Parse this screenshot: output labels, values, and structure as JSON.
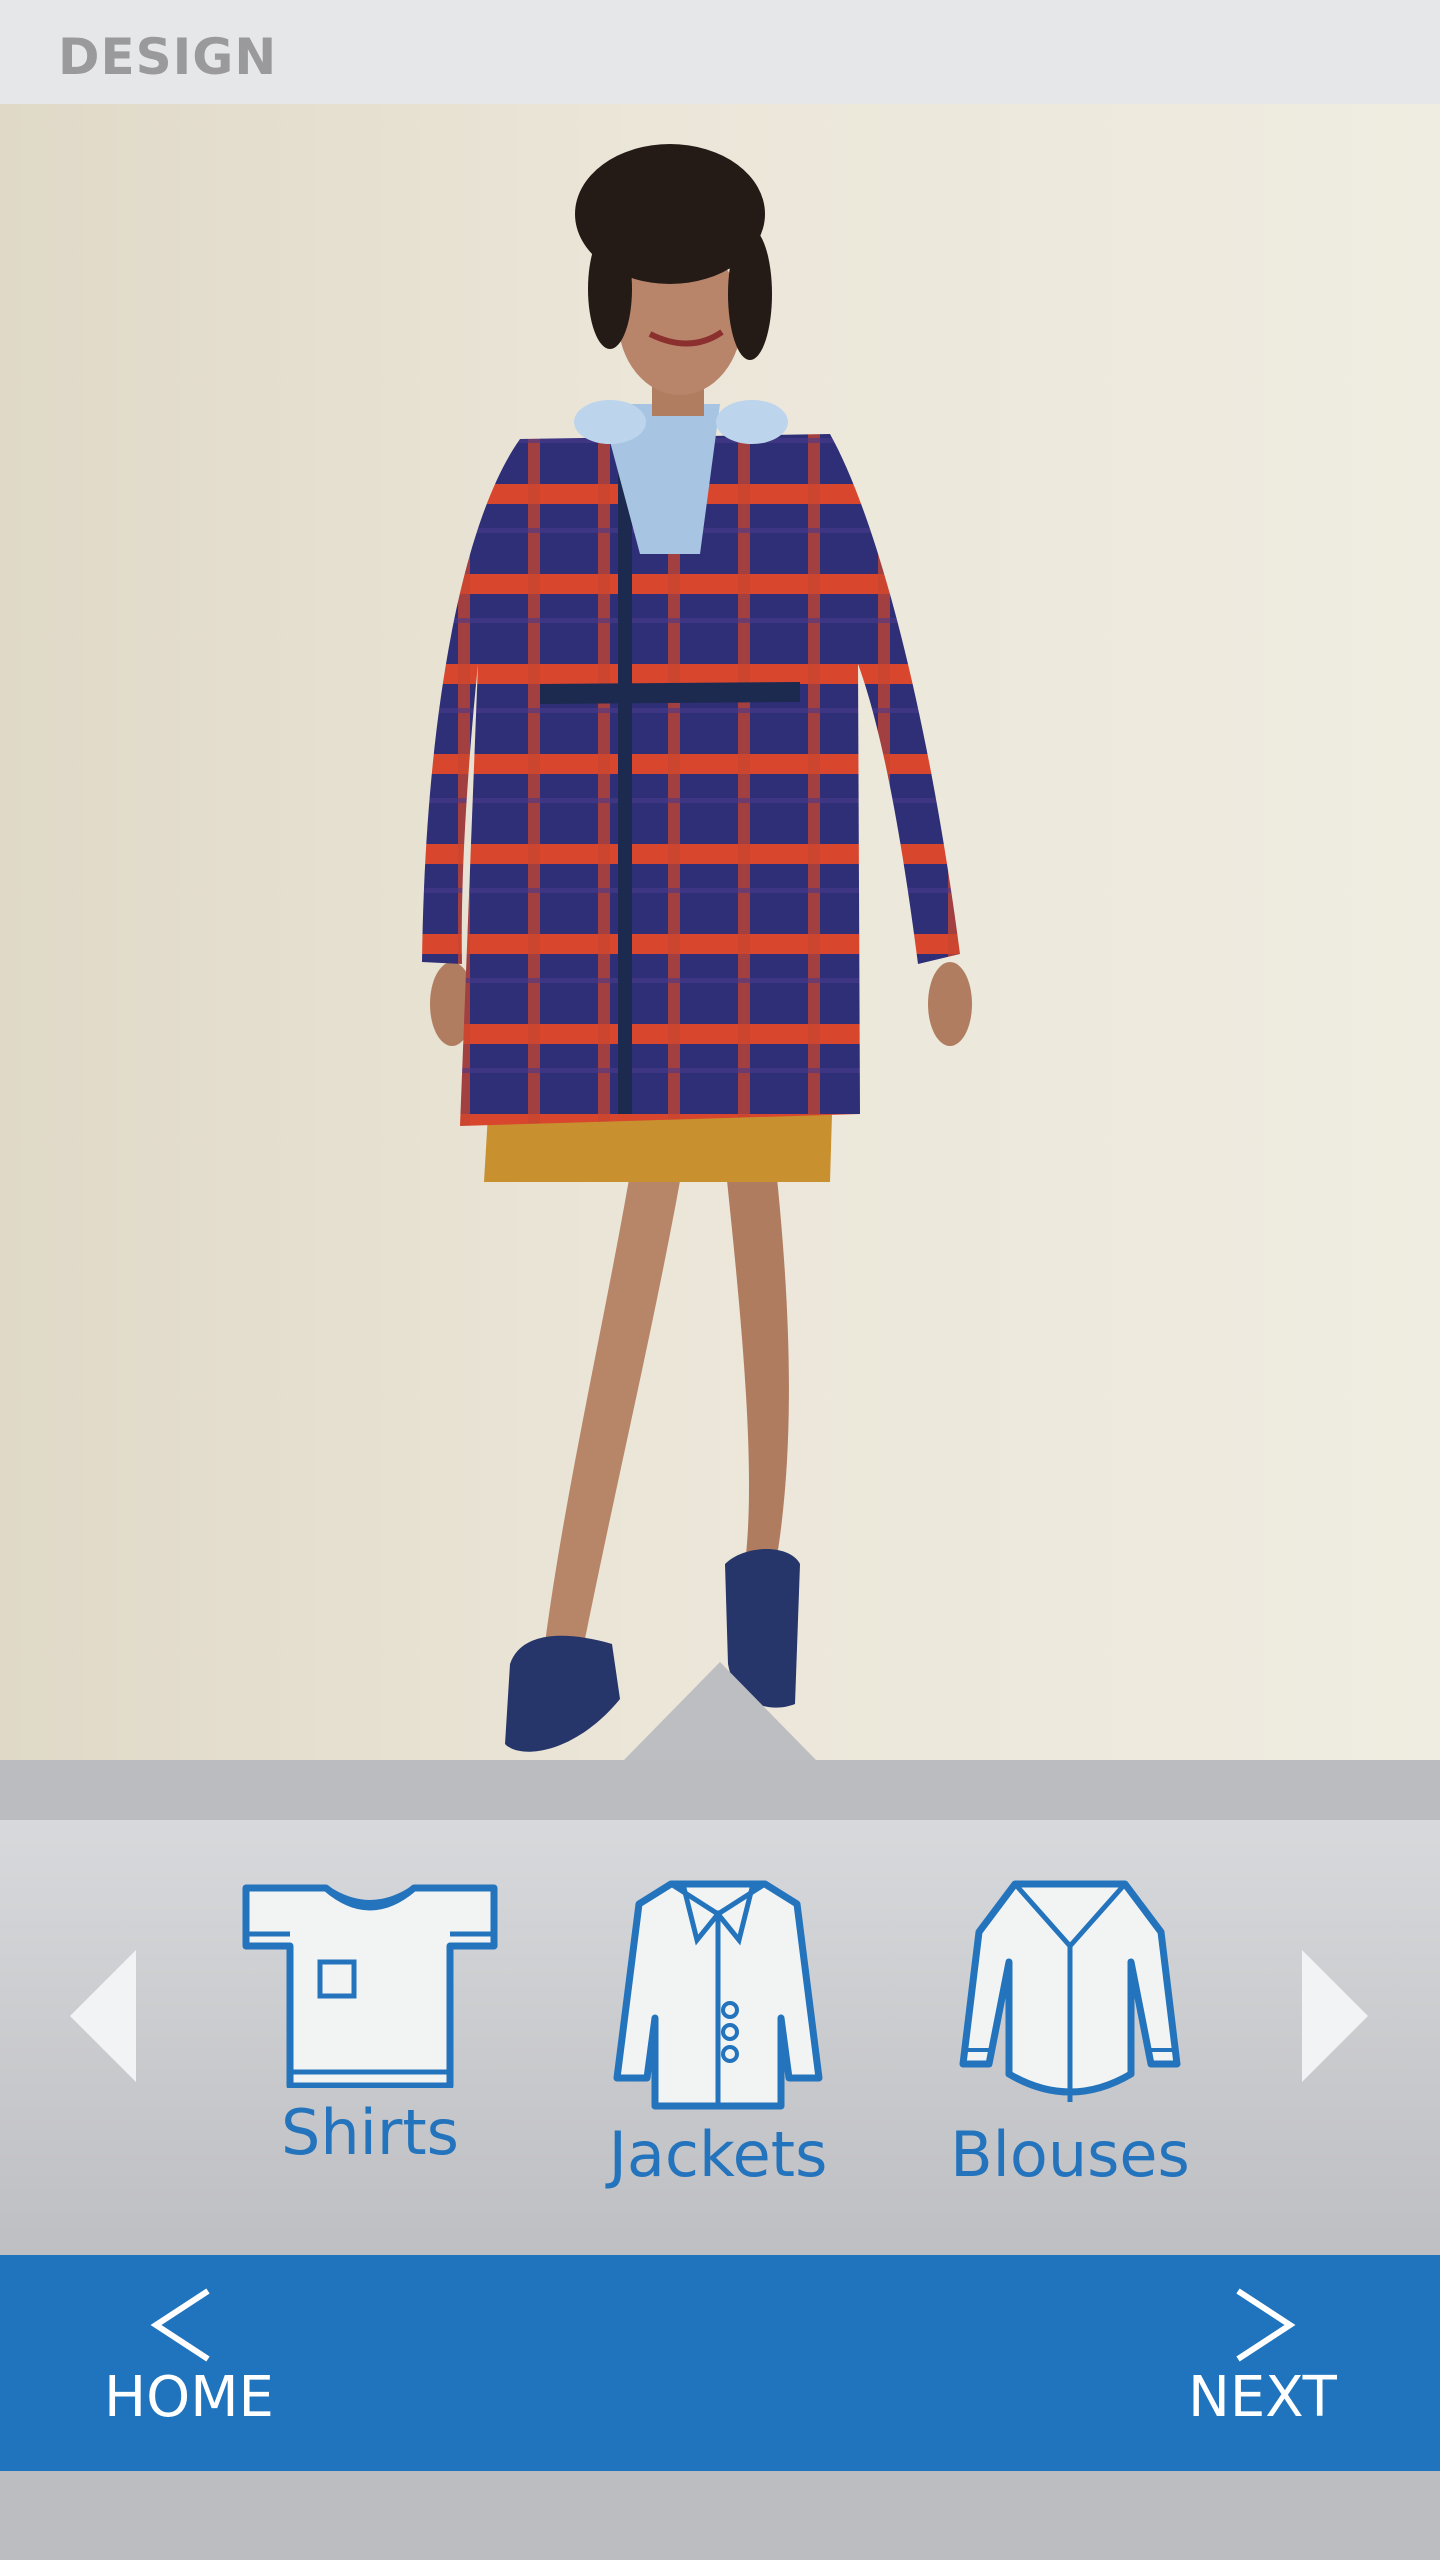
{
  "header": {
    "title": "DESIGN"
  },
  "categories": {
    "items": [
      {
        "label": "Shirts",
        "icon": "t-shirt-icon"
      },
      {
        "label": "Jackets",
        "icon": "jacket-icon"
      },
      {
        "label": "Blouses",
        "icon": "blouse-icon"
      }
    ],
    "prev_icon": "triangle-left-icon",
    "next_icon": "triangle-right-icon"
  },
  "nav": {
    "home_label": "HOME",
    "next_label": "NEXT"
  },
  "colors": {
    "accent": "#1f74bd",
    "header_bg": "#e6e7e9",
    "icon_stroke": "#2474bd"
  },
  "photo": {
    "content": "model wearing plaid coat"
  }
}
